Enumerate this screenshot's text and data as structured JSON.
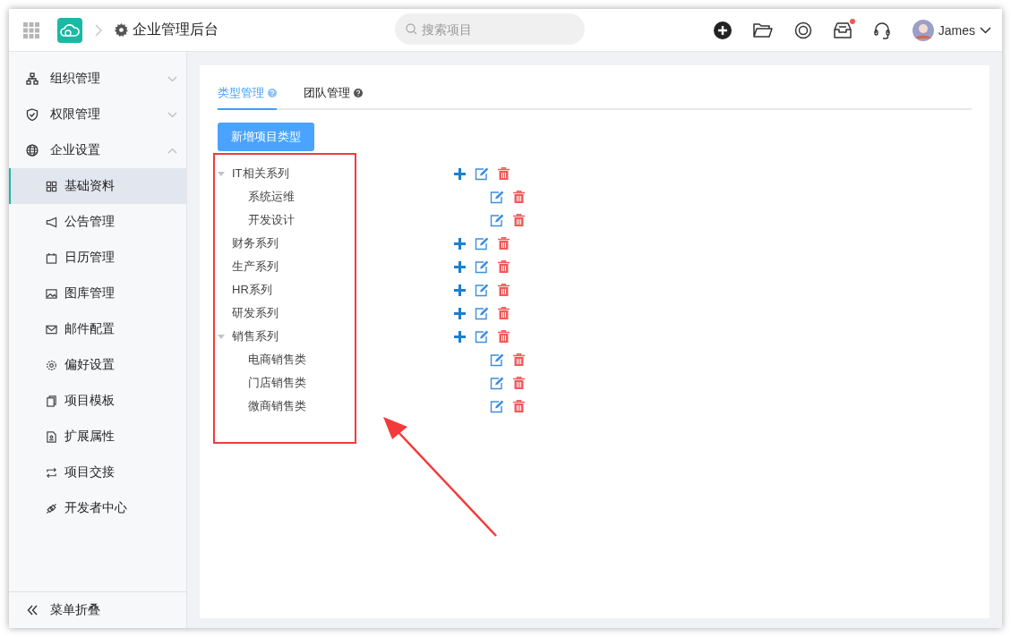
{
  "header": {
    "title": "企业管理后台",
    "search": {
      "placeholder": "搜索项目"
    },
    "inbox_unread": true,
    "user": {
      "name": "James"
    }
  },
  "sidebar": {
    "items": [
      {
        "label": "组织管理",
        "expanded": false
      },
      {
        "label": "权限管理",
        "expanded": false
      },
      {
        "label": "企业设置",
        "expanded": true,
        "children": [
          {
            "label": "基础资料",
            "selected": true
          },
          {
            "label": "公告管理",
            "selected": false
          },
          {
            "label": "日历管理",
            "selected": false
          },
          {
            "label": "图库管理",
            "selected": false
          },
          {
            "label": "邮件配置",
            "selected": false
          },
          {
            "label": "偏好设置",
            "selected": false
          },
          {
            "label": "项目模板",
            "selected": false
          },
          {
            "label": "扩展属性",
            "selected": false
          },
          {
            "label": "项目交接",
            "selected": false
          },
          {
            "label": "开发者中心",
            "selected": false
          }
        ]
      }
    ],
    "collapse_label": "菜单折叠"
  },
  "tabs": [
    {
      "label": "类型管理",
      "selected": true
    },
    {
      "label": "团队管理",
      "selected": false
    }
  ],
  "add_button": "新增项目类型",
  "tree": [
    {
      "label": "IT相关系列",
      "expanded": true,
      "children": [
        {
          "label": "系统运维"
        },
        {
          "label": "开发设计"
        }
      ]
    },
    {
      "label": "财务系列"
    },
    {
      "label": "生产系列"
    },
    {
      "label": "HR系列"
    },
    {
      "label": "研发系列"
    },
    {
      "label": "销售系列",
      "expanded": true,
      "children": [
        {
          "label": "电商销售类"
        },
        {
          "label": "门店销售类"
        },
        {
          "label": "微商销售类"
        }
      ]
    }
  ]
}
